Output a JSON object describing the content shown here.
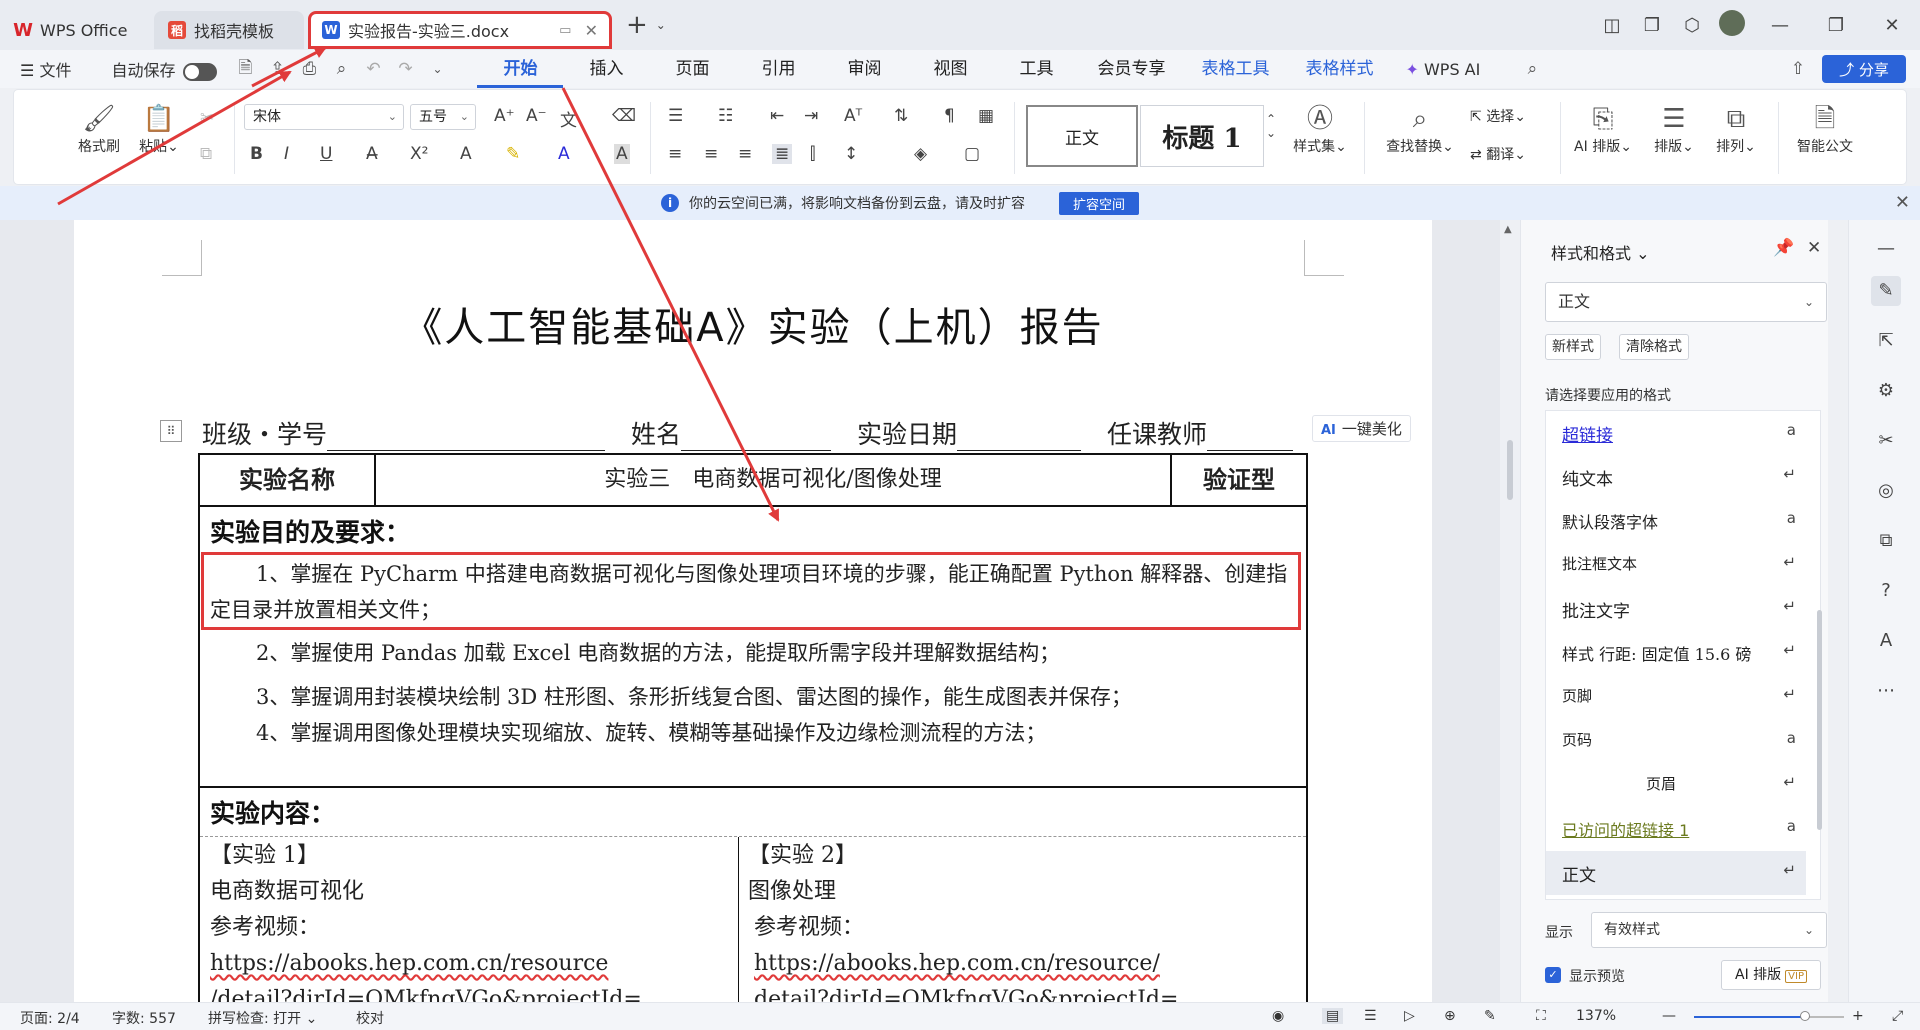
{
  "tabs": {
    "wps": "WPS Office",
    "template": "找稻壳模板",
    "doc": "实验报告-实验三.docx"
  },
  "menubar": {
    "file": "文件",
    "autosave": "自动保存",
    "tabs": [
      "开始",
      "插入",
      "页面",
      "引用",
      "审阅",
      "视图",
      "工具",
      "会员专享",
      "表格工具",
      "表格样式"
    ],
    "wpsai": "WPS AI",
    "share": "分享"
  },
  "ribbon": {
    "format_painter": "格式刷",
    "paste": "粘贴",
    "font": "宋体",
    "size": "五号",
    "style_normal": "正文",
    "style_h1": "标题 1",
    "style_set": "样式集",
    "find_replace": "查找替换",
    "select": "选择",
    "translate": "翻译",
    "ai_layout": "AI 排版",
    "layout": "排版",
    "arrange": "排列",
    "smart_doc": "智能公文"
  },
  "notice": {
    "text": "你的云空间已满，将影响文档备份到云盘，请及时扩容",
    "button": "扩容空间"
  },
  "document": {
    "title": "《人工智能基础A》实验（上机）报告",
    "info": {
      "class": "班级・学号",
      "name": "姓名",
      "date": "实验日期",
      "teacher": "任课教师"
    },
    "beautify": "一键美化",
    "beautify_ai": "AI",
    "table": {
      "h_name": "实验名称",
      "exp_name": "实验三　电商数据可视化/图像处理",
      "exp_type": "验证型",
      "objective_title": "实验目的及要求：",
      "objectives": [
        "1、掌握在 PyCharm 中搭建电商数据可视化与图像处理项目环境的步骤，能正确配置 Python 解释器、创建指定目录并放置相关文件；",
        "2、掌握使用 Pandas 加载 Excel 电商数据的方法，能提取所需字段并理解数据结构；",
        "3、掌握调用封装模块绘制 3D 柱形图、条形折线复合图、雷达图的操作，能生成图表并保存；",
        "4、掌握调用图像处理模块实现缩放、旋转、模糊等基础操作及边缘检测流程的方法；"
      ],
      "content_title": "实验内容：",
      "exp1": {
        "tag": "【实验 1】",
        "name": "电商数据可视化",
        "ref": "参考视频：",
        "url1": "https://abooks.hep.com.cn/resource",
        "url2": "/detail?dirId=OMkfngVGo&projectId="
      },
      "exp2": {
        "tag": "【实验 2】",
        "name": "图像处理",
        "ref": "参考视频：",
        "url1": "https://abooks.hep.com.cn/resource/",
        "url2": "detail?dirId=OMkfngVGo&projectId="
      }
    }
  },
  "panel": {
    "title": "样式和格式",
    "current": "正文",
    "new_style": "新样式",
    "clear_format": "清除格式",
    "choose_label": "请选择要应用的格式",
    "styles": [
      {
        "name": "超链接",
        "sym": "a"
      },
      {
        "name": "纯文本",
        "sym": "↵"
      },
      {
        "name": "默认段落字体",
        "sym": "a"
      },
      {
        "name": "批注框文本",
        "sym": "↵"
      },
      {
        "name": "批注文字",
        "sym": "↵"
      },
      {
        "name": "样式 行距: 固定值 15.6 磅",
        "sym": "↵"
      },
      {
        "name": "页脚",
        "sym": "↵"
      },
      {
        "name": "页码",
        "sym": "a"
      },
      {
        "name": "页眉",
        "sym": "↵"
      },
      {
        "name": "已访问的超链接 1",
        "sym": "a"
      },
      {
        "name": "正文",
        "sym": "↵"
      }
    ],
    "show_label": "显示",
    "show_value": "有效样式",
    "preview": "显示预览",
    "ai_layout": "AI 排版",
    "vip": "VIP"
  },
  "status": {
    "page": "页面: 2/4",
    "words": "字数: 557",
    "spell": "拼写检查: 打开",
    "proof": "校对",
    "zoom": "137%",
    "zoom_fraction": 0.37
  },
  "colors": {
    "accent": "#2b63d8",
    "annotation": "#e03a3a"
  }
}
